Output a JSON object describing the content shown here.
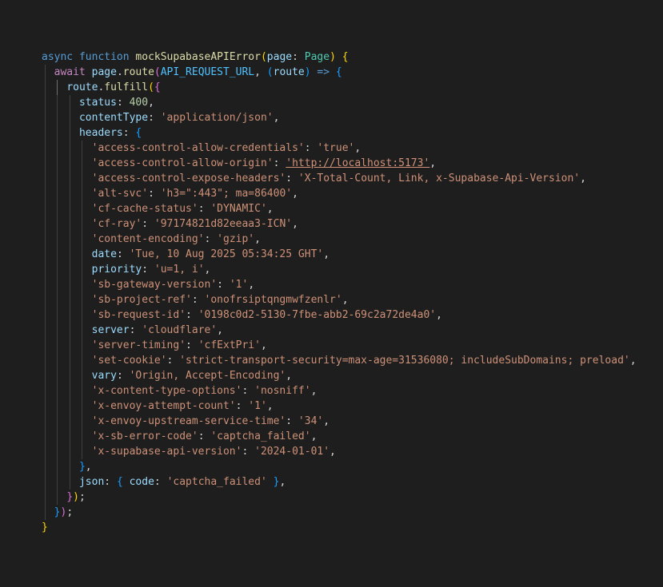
{
  "code": {
    "fn_async": "async",
    "fn_function": "function",
    "fn_name": "mockSupabaseAPIError",
    "param_name": "page",
    "param_type": "Page",
    "await_kw": "await",
    "page_obj": "page",
    "route_method": "route",
    "url_const": "API_REQUEST_URL",
    "route_param": "route",
    "arrow": "=>",
    "fulfill_obj": "route",
    "fulfill_method": "fulfill",
    "status_key": "status",
    "status_value": "400",
    "content_type_key": "contentType",
    "content_type_value": "'application/json'",
    "headers_key": "headers",
    "headers": [
      {
        "key": "'access-control-allow-credentials'",
        "value": "'true'"
      },
      {
        "key": "'access-control-allow-origin'",
        "value": "'http://localhost:5173'"
      },
      {
        "key": "'access-control-expose-headers'",
        "value": "'X-Total-Count, Link, x-Supabase-Api-Version'"
      },
      {
        "key": "'alt-svc'",
        "value": "'h3=\":443\"; ma=86400'"
      },
      {
        "key": "'cf-cache-status'",
        "value": "'DYNAMIC'"
      },
      {
        "key": "'cf-ray'",
        "value": "'97174821d82eeaa3-ICN'"
      },
      {
        "key": "'content-encoding'",
        "value": "'gzip'"
      },
      {
        "key": "date",
        "value": "'Tue, 10 Aug 2025 05:34:25 GHT'"
      },
      {
        "key": "priority",
        "value": "'u=1, i'"
      },
      {
        "key": "'sb-gateway-version'",
        "value": "'1'"
      },
      {
        "key": "'sb-project-ref'",
        "value": "'onofrsiptqngmwfzenlr'"
      },
      {
        "key": "'sb-request-id'",
        "value": "'0198c0d2-5130-7fbe-abb2-69c2a72de4a0'"
      },
      {
        "key": "server",
        "value": "'cloudflare'"
      },
      {
        "key": "'server-timing'",
        "value": "'cfExtPri'"
      },
      {
        "key": "'set-cookie'",
        "value": "'strict-transport-security=max-age=31536080; includeSubDomains; preload'"
      },
      {
        "key": "vary",
        "value": "'Origin, Accept-Encoding'"
      },
      {
        "key": "'x-content-type-options'",
        "value": "'nosniff'"
      },
      {
        "key": "'x-envoy-attempt-count'",
        "value": "'1'"
      },
      {
        "key": "'x-envoy-upstream-service-time'",
        "value": "'34'"
      },
      {
        "key": "'x-sb-error-code'",
        "value": "'captcha_failed'"
      },
      {
        "key": "'x-supabase-api-version'",
        "value": "'2024-01-01'"
      }
    ],
    "json_key": "json",
    "code_key": "code",
    "code_value": "'captcha_failed'"
  }
}
